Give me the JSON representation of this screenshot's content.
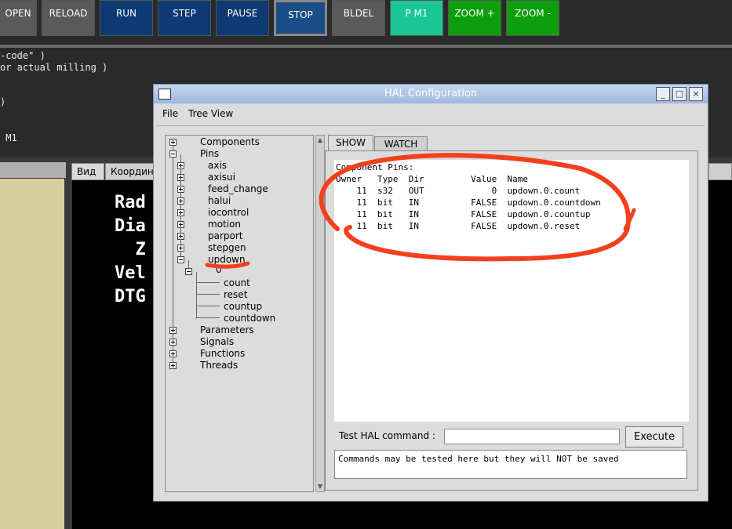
{
  "toolbar": {
    "buttons": [
      {
        "label": "OPEN",
        "bg": "#5a5a5a"
      },
      {
        "label": "RELOAD",
        "bg": "#5a5a5a"
      },
      {
        "label": "RUN",
        "bg": "#0d3a72"
      },
      {
        "label": "STEP",
        "bg": "#0d3a72"
      },
      {
        "label": "PAUSE",
        "bg": "#0d3a72"
      },
      {
        "label": "STOP",
        "bg": "#1b4d86"
      },
      {
        "label": "BLDEL",
        "bg": "#5a5a5a"
      },
      {
        "label": "P M1",
        "bg": "#19c694"
      },
      {
        "label": "ZOOM +",
        "bg": "#0d9e0d"
      },
      {
        "label": "ZOOM -",
        "bg": "#0d9e0d"
      }
    ]
  },
  "gcode": {
    "lines": [
      "-code\" )",
      "or actual milling )",
      "",
      "",
      ")",
      "",
      "",
      " M1"
    ]
  },
  "main_tabs": {
    "tab1": "Вид",
    "tab2": "Координ"
  },
  "dro": {
    "lines": [
      "Rad",
      "Dia",
      "  Z",
      "Vel",
      "DTG"
    ]
  },
  "window": {
    "title": "HAL Configuration",
    "minimize": "_",
    "maximize": "□",
    "close": "×"
  },
  "menu": {
    "file": "File",
    "tree_view": "Tree View"
  },
  "tree": {
    "components": "Components",
    "pins": "Pins",
    "pin_children": [
      "axis",
      "axisui",
      "feed_change",
      "halui",
      "iocontrol",
      "motion",
      "parport",
      "stepgen",
      "updown"
    ],
    "updown_child": "0",
    "updown_leaves": [
      "count",
      "reset",
      "countup",
      "countdown"
    ],
    "parameters": "Parameters",
    "signals": "Signals",
    "functions": "Functions",
    "threads": "Threads"
  },
  "tabs": {
    "show": "SHOW",
    "watch": "WATCH"
  },
  "pins_table": {
    "heading": "Component Pins:",
    "header": "Owner   Type  Dir         Value  Name",
    "rows": [
      "    11  s32   OUT             0  updown.0.count",
      "    11  bit   IN          FALSE  updown.0.countdown",
      "    11  bit   IN          FALSE  updown.0.countup",
      "    11  bit   IN          FALSE  updown.0.reset"
    ]
  },
  "command": {
    "label": "Test HAL command :",
    "value": "",
    "execute": "Execute",
    "output": "Commands may be tested here but they will NOT be saved"
  },
  "colors": {
    "annotation": "#f2401e"
  }
}
